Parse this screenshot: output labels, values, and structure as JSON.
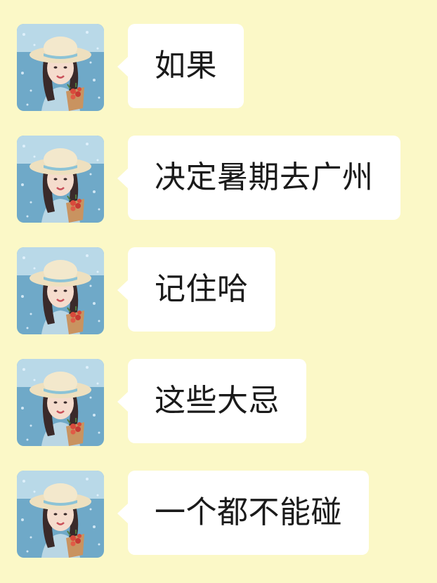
{
  "conversation": {
    "messages": [
      {
        "text": "如果"
      },
      {
        "text": "决定暑期去广州"
      },
      {
        "text": "记住哈"
      },
      {
        "text": "这些大忌"
      },
      {
        "text": "一个都不能碰"
      }
    ]
  },
  "theme": {
    "background": "#fbf8c7",
    "bubble": "#ffffff",
    "text": "#1a1a1a"
  },
  "icons": {
    "avatar": "user-avatar-photo"
  }
}
